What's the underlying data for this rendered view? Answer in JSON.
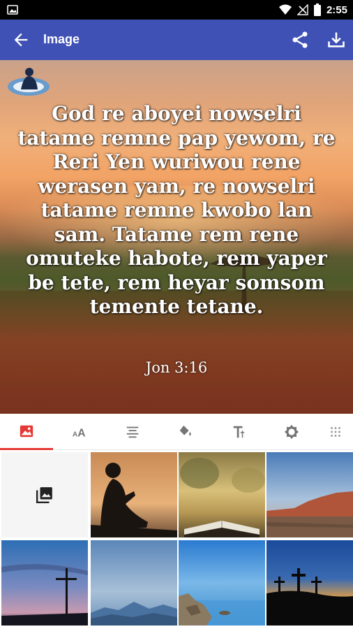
{
  "status_bar": {
    "time": "2:55",
    "icons": [
      "image-notification-icon",
      "wifi-icon",
      "no-signal-icon",
      "battery-icon"
    ]
  },
  "app_bar": {
    "title": "Image",
    "color": "#3f51b5",
    "icons": [
      "back-arrow-icon",
      "share-icon",
      "download-icon"
    ]
  },
  "verse": {
    "text": "God re aboyei nowselri tatame remne pap yewom, re Reri Yen wuriwou rene werasen yam, re nowselri tatame remne kwobo lan sam. Tatame rem rene omuteke habote, rem yaper be tete, rem heyar somsom temente tetane.",
    "reference": "Jon 3:16"
  },
  "tools": {
    "active_color": "#e53935",
    "tabs": [
      {
        "name": "image-tab",
        "icon": "image-icon",
        "active": true
      },
      {
        "name": "font-size-tab",
        "icon": "font-size-icon",
        "active": false
      },
      {
        "name": "align-tab",
        "icon": "align-center-icon",
        "active": false
      },
      {
        "name": "color-fill-tab",
        "icon": "paint-bucket-icon",
        "active": false
      },
      {
        "name": "text-style-tab",
        "icon": "text-format-icon",
        "active": false
      },
      {
        "name": "brightness-tab",
        "icon": "brightness-icon",
        "active": false
      },
      {
        "name": "more-tab",
        "icon": "grid-dots-icon",
        "active": false
      }
    ]
  },
  "backgrounds": [
    {
      "name": "gallery-picker",
      "icon": "photo-library-icon"
    },
    {
      "name": "silhouette-reading-sunset"
    },
    {
      "name": "open-bible-golden-blur"
    },
    {
      "name": "red-rock-mesa-sky"
    },
    {
      "name": "cross-at-dusk"
    },
    {
      "name": "misty-blue-mountains"
    },
    {
      "name": "rocky-blue-lake"
    },
    {
      "name": "three-crosses-sunset"
    }
  ]
}
